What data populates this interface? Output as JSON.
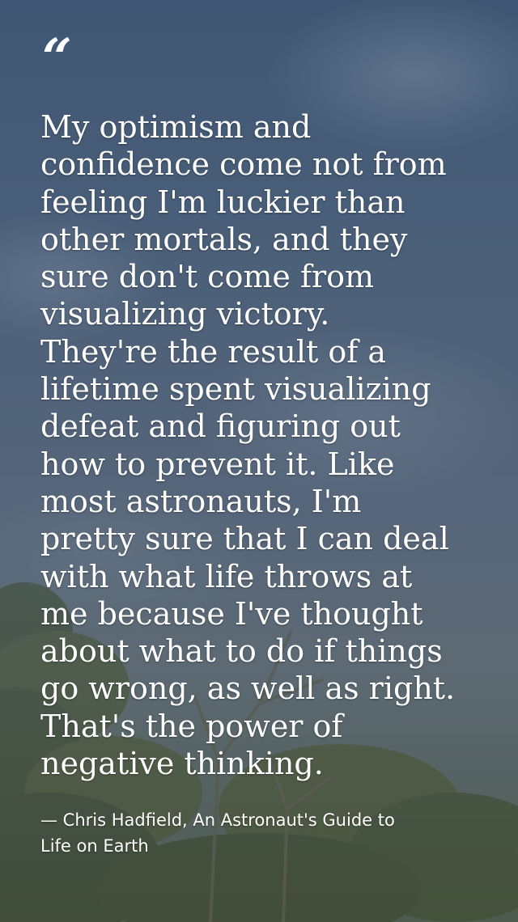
{
  "quote": {
    "mark": "“",
    "lines": [
      "My optimism and",
      "confidence come not from",
      "feeling I'm luckier than",
      "other mortals, and they",
      "sure don't come from",
      "visualizing victory.",
      "They're the result of a",
      "lifetime spent visualizing",
      "defeat and figuring out",
      "how to prevent it. Like",
      "most astronauts, I'm",
      "pretty sure that I can deal",
      "with what life throws at",
      "me because I've thought",
      "about what to do if things",
      "go wrong, as well as right.",
      "That's the power of",
      "negative thinking."
    ]
  },
  "attribution": {
    "lines": [
      "— Chris Hadfield, An Astronaut's Guide to",
      "Life on Earth"
    ]
  }
}
